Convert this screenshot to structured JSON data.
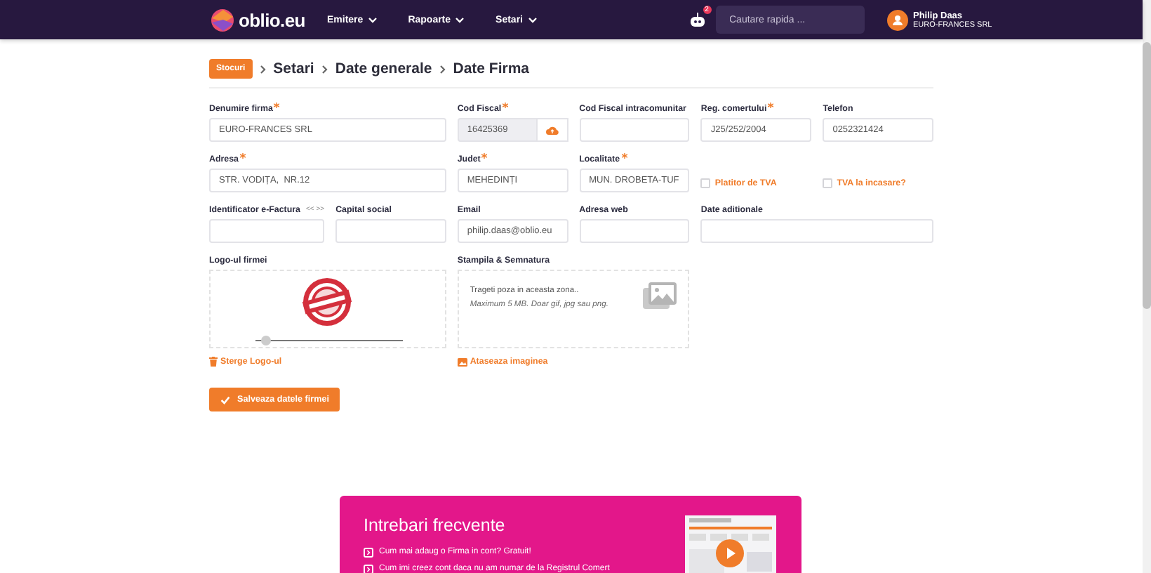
{
  "navbar": {
    "brand": "oblio.eu",
    "menus": [
      {
        "label": "Emitere"
      },
      {
        "label": "Rapoarte"
      },
      {
        "label": "Setari"
      }
    ],
    "notification_count": "2",
    "search": {
      "placeholder": "Cautare rapida ..."
    },
    "user": {
      "name": "Philip Daas",
      "company": "EURO-FRANCES SRL"
    }
  },
  "breadcrumb": {
    "badge": "Stocuri",
    "items": [
      "Setari",
      "Date generale",
      "Date Firma"
    ]
  },
  "form": {
    "fields": [
      {
        "kind": "wide_input",
        "label": "Denumire firma",
        "required": true,
        "value": "EURO-FRANCES SRL",
        "disabled": false
      },
      {
        "kind": "fiscal_input",
        "label": "Cod Fiscal",
        "required": true,
        "value": "16425369",
        "disabled": true
      },
      {
        "kind": "input",
        "label": "Cod Fiscal intracomunitar",
        "required": false,
        "disabled": false
      },
      {
        "kind": "input",
        "label": "Reg. comertului",
        "required": true,
        "value": "J25/252/2004",
        "disabled": false
      },
      {
        "kind": "input",
        "label": "Telefon",
        "required": false,
        "value": "0252321424",
        "disabled": false
      },
      {
        "kind": "wide_input",
        "label": "Adresa",
        "required": true,
        "value": "STR. VODIȚA,  NR.12",
        "disabled": false
      },
      {
        "kind": "input",
        "label": "Judet",
        "required": true,
        "value": "MEHEDINȚI",
        "disabled": false
      },
      {
        "kind": "input",
        "label": "Localitate",
        "required": true,
        "value": "MUN. DROBETA-TUF",
        "disabled": false
      },
      {
        "kind": "checkbox",
        "label": "Platitor de TVA",
        "checked": false
      },
      {
        "kind": "checkbox",
        "label": "TVA la incasare?",
        "checked": false
      },
      {
        "kind": "input",
        "label": "Identificator e-Factura",
        "required": false,
        "disabled": false,
        "label_hint": "<< >>"
      },
      {
        "kind": "input",
        "label": "Capital social",
        "required": false,
        "disabled": false
      },
      {
        "kind": "input",
        "label": "Email",
        "required": false,
        "value": "philip.daas@oblio.eu",
        "disabled": false
      },
      {
        "kind": "input",
        "label": "Adresa web",
        "required": false,
        "disabled": false
      },
      {
        "kind": "wide_input",
        "label": "Date aditionale",
        "required": false,
        "disabled": false
      }
    ],
    "uploads": [
      {
        "kind": "logo",
        "label": "Logo-ul firmei",
        "zoom": {
          "level": 0.07
        },
        "action": "Sterge Logo-ul"
      },
      {
        "kind": "dropzone",
        "label": "Stampila & Semnatura",
        "hint": "Trageti poza in aceasta zona..",
        "note": "Maximum 5 MB. Doar gif, jpg sau png.",
        "action": "Ataseaza imaginea"
      }
    ],
    "save_button": "Salveaza datele firmei"
  },
  "faq": {
    "title": "Intrebari frecvente",
    "items": [
      "Cum mai adaug o Firma in cont? Gratuit!",
      "Cum imi creez cont daca nu am numar de la Registrul Comert"
    ]
  }
}
